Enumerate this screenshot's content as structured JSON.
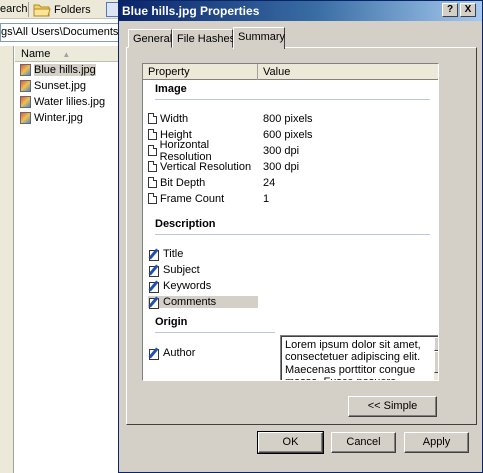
{
  "explorer": {
    "toolbar": {
      "search_label": "earch",
      "folders_label": "Folders"
    },
    "address": "gs\\All Users\\Documents\\My",
    "column_header": "Name",
    "files": [
      {
        "name": "Blue hills.jpg",
        "selected": true
      },
      {
        "name": "Sunset.jpg",
        "selected": false
      },
      {
        "name": "Water lilies.jpg",
        "selected": false
      },
      {
        "name": "Winter.jpg",
        "selected": false
      }
    ]
  },
  "dialog": {
    "title": "Blue hills.jpg Properties",
    "help_button": "?",
    "close_button": "X",
    "tabs": [
      "General",
      "File Hashes",
      "Summary"
    ],
    "active_tab": "Summary",
    "columns": {
      "property": "Property",
      "value": "Value"
    },
    "groups": {
      "image": "Image",
      "description": "Description",
      "origin": "Origin"
    },
    "image_rows": [
      {
        "property": "Width",
        "value": "800 pixels"
      },
      {
        "property": "Height",
        "value": "600 pixels"
      },
      {
        "property": "Horizontal Resolution",
        "value": "300 dpi"
      },
      {
        "property": "Vertical Resolution",
        "value": "300 dpi"
      },
      {
        "property": "Bit Depth",
        "value": "24"
      },
      {
        "property": "Frame Count",
        "value": "1"
      }
    ],
    "description_rows": [
      {
        "property": "Title"
      },
      {
        "property": "Subject"
      },
      {
        "property": "Keywords"
      },
      {
        "property": "Comments"
      }
    ],
    "origin_rows": [
      {
        "property": "Author"
      }
    ],
    "comments_value": "Lorem ipsum dolor sit amet, consectetuer adipiscing elit. Maecenas porttitor congue massa. Fusce posuere, magna sed pulvinar ultricies, purus lectus malesuada libero, sit amet",
    "simple_button": "<< Simple",
    "ok_button": "OK",
    "cancel_button": "Cancel",
    "apply_button": "Apply"
  }
}
